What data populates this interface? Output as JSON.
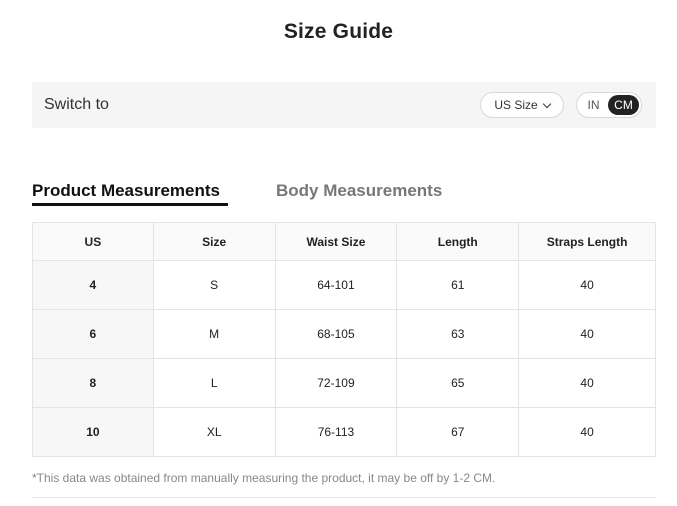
{
  "page": {
    "title": "Size Guide"
  },
  "switch_bar": {
    "label": "Switch to",
    "size_select": {
      "selected": "US Size"
    },
    "unit_toggle": {
      "options": [
        "IN",
        "CM"
      ],
      "active": "CM"
    }
  },
  "tabs": [
    {
      "label": "Product Measurements",
      "active": true
    },
    {
      "label": "Body Measurements",
      "active": false
    }
  ],
  "table": {
    "headers": [
      "US",
      "Size",
      "Waist Size",
      "Length",
      "Straps Length"
    ],
    "rows": [
      [
        "4",
        "S",
        "64-101",
        "61",
        "40"
      ],
      [
        "6",
        "M",
        "68-105",
        "63",
        "40"
      ],
      [
        "8",
        "L",
        "72-109",
        "65",
        "40"
      ],
      [
        "10",
        "XL",
        "76-113",
        "67",
        "40"
      ]
    ]
  },
  "footnote": "*This data was obtained from manually measuring the product, it may be off by 1-2 CM."
}
